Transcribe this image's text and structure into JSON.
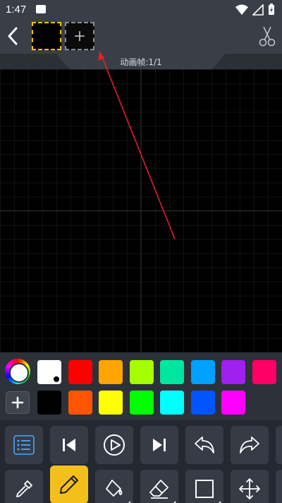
{
  "status_bar": {
    "time": "1:47"
  },
  "header": {
    "frame_counter": "动画帧:1/1"
  },
  "palette": {
    "row1": [
      "#ffffff",
      "#ff0000",
      "#ffa500",
      "#a6ff00",
      "#00e6a0",
      "#00a2ff",
      "#a020f0",
      "#ff0066"
    ],
    "row2": [
      "#000000",
      "#ff5500",
      "#ffff00",
      "#00ff00",
      "#00ffff",
      "#0055ff",
      "#ff00ff"
    ],
    "selected_color": "#ffffff"
  },
  "toolbar": {
    "row1": [
      "list-icon",
      "skip-start-icon",
      "play-icon",
      "skip-end-icon",
      "undo-icon",
      "redo-icon"
    ],
    "row2": [
      "eyedropper-icon",
      "pencil-icon",
      "fill-bucket-icon",
      "eraser-icon",
      "rectangle-icon",
      "move-icon"
    ],
    "active_tool": "pencil-icon"
  },
  "colors": {
    "accent": "#f3c01b",
    "header_bg": "#3a3e47",
    "annotation_arrow": "#e0202a"
  }
}
